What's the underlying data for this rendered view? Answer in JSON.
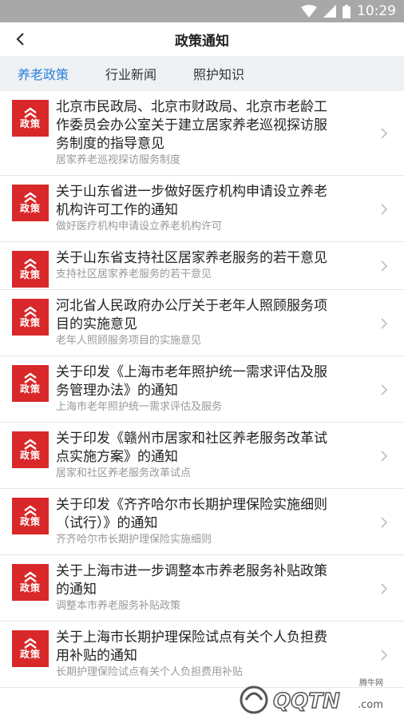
{
  "status": {
    "time": "10:29"
  },
  "header": {
    "title": "政策通知"
  },
  "tabs": [
    {
      "label": "养老政策",
      "active": true
    },
    {
      "label": "行业新闻",
      "active": false
    },
    {
      "label": "照护知识",
      "active": false
    }
  ],
  "badge_label": "政策",
  "items": [
    {
      "title_lines": [
        "北京市民政局、北京市财政局、北京市老龄工",
        "作委员会办公室关于建立居家养老巡视探访服",
        "务制度的指导意见"
      ],
      "subtitle": "居家养老巡视探访服务制度"
    },
    {
      "title_lines": [
        "关于山东省进一步做好医疗机构申请设立养老",
        "机构许可工作的通知"
      ],
      "subtitle": "做好医疗机构申请设立养老机构许可"
    },
    {
      "title_lines": [
        "关于山东省支持社区居家养老服务的若干意见"
      ],
      "subtitle": "支持社区居家养老服务的若干意见"
    },
    {
      "title_lines": [
        "河北省人民政府办公厅关于老年人照顾服务项",
        "目的实施意见"
      ],
      "subtitle": "老年人照顾服务项目的实施意见"
    },
    {
      "title_lines": [
        "关于印发《上海市老年照护统一需求评估及服",
        "务管理办法》的通知"
      ],
      "subtitle": "上海市老年照护统一需求评估及服务"
    },
    {
      "title_lines": [
        "关于印发《赣州市居家和社区养老服务改革试",
        "点实施方案》的通知"
      ],
      "subtitle": "居家和社区养老服务改革试点"
    },
    {
      "title_lines": [
        "关于印发《齐齐哈尔市长期护理保险实施细则",
        "（试行）》的通知"
      ],
      "subtitle": "齐齐哈尔市长期护理保险实施细则"
    },
    {
      "title_lines": [
        "关于上海市进一步调整本市养老服务补贴政策",
        "的通知"
      ],
      "subtitle": "调整本市养老服务补贴政策"
    },
    {
      "title_lines": [
        "关于上海市长期护理保险试点有关个人负担费",
        "用补贴的通知"
      ],
      "subtitle": "长期护理保险试点有关个人负担费用补贴"
    }
  ],
  "watermark": {
    "text": "腾牛网",
    "logo": "QQTN.com"
  }
}
